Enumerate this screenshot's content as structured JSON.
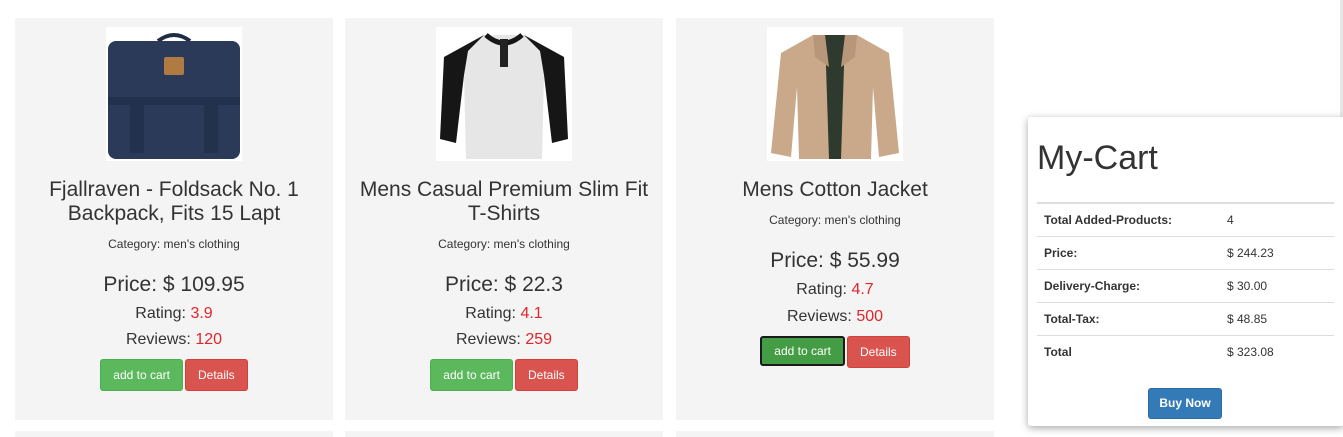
{
  "products": [
    {
      "title": "Fjallraven - Foldsack No. 1 Backpack, Fits 15 Lapt",
      "category": "Category: men's clothing",
      "price": "Price: $ 109.95",
      "rating_label": "Rating: ",
      "rating": "3.9",
      "reviews_label": "Reviews: ",
      "reviews": "120",
      "add_label": "add to cart",
      "details_label": "Details",
      "image": "backpack-image"
    },
    {
      "title": "Mens Casual Premium Slim Fit T-Shirts",
      "category": "Category: men's clothing",
      "price": "Price: $ 22.3",
      "rating_label": "Rating: ",
      "rating": "4.1",
      "reviews_label": "Reviews: ",
      "reviews": "259",
      "add_label": "add to cart",
      "details_label": "Details",
      "image": "tshirt-image"
    },
    {
      "title": "Mens Cotton Jacket",
      "category": "Category: men's clothing",
      "price": "Price: $ 55.99",
      "rating_label": "Rating: ",
      "rating": "4.7",
      "reviews_label": "Reviews: ",
      "reviews": "500",
      "add_label": "add to cart",
      "details_label": "Details",
      "image": "jacket-image"
    }
  ],
  "cart": {
    "title": "My-Cart",
    "rows": [
      {
        "label": "Total Added-Products:",
        "value": "4"
      },
      {
        "label": "Price:",
        "value": "$ 244.23"
      },
      {
        "label": "Delivery-Charge:",
        "value": "$ 30.00"
      },
      {
        "label": "Total-Tax:",
        "value": "$ 48.85"
      },
      {
        "label": "Total",
        "value": "$ 323.08"
      }
    ],
    "buy_label": "Buy Now"
  },
  "colors": {
    "add": "#5cb85c",
    "details": "#d9534f",
    "buy": "#337ab7",
    "accent_value": "#e0262b"
  }
}
